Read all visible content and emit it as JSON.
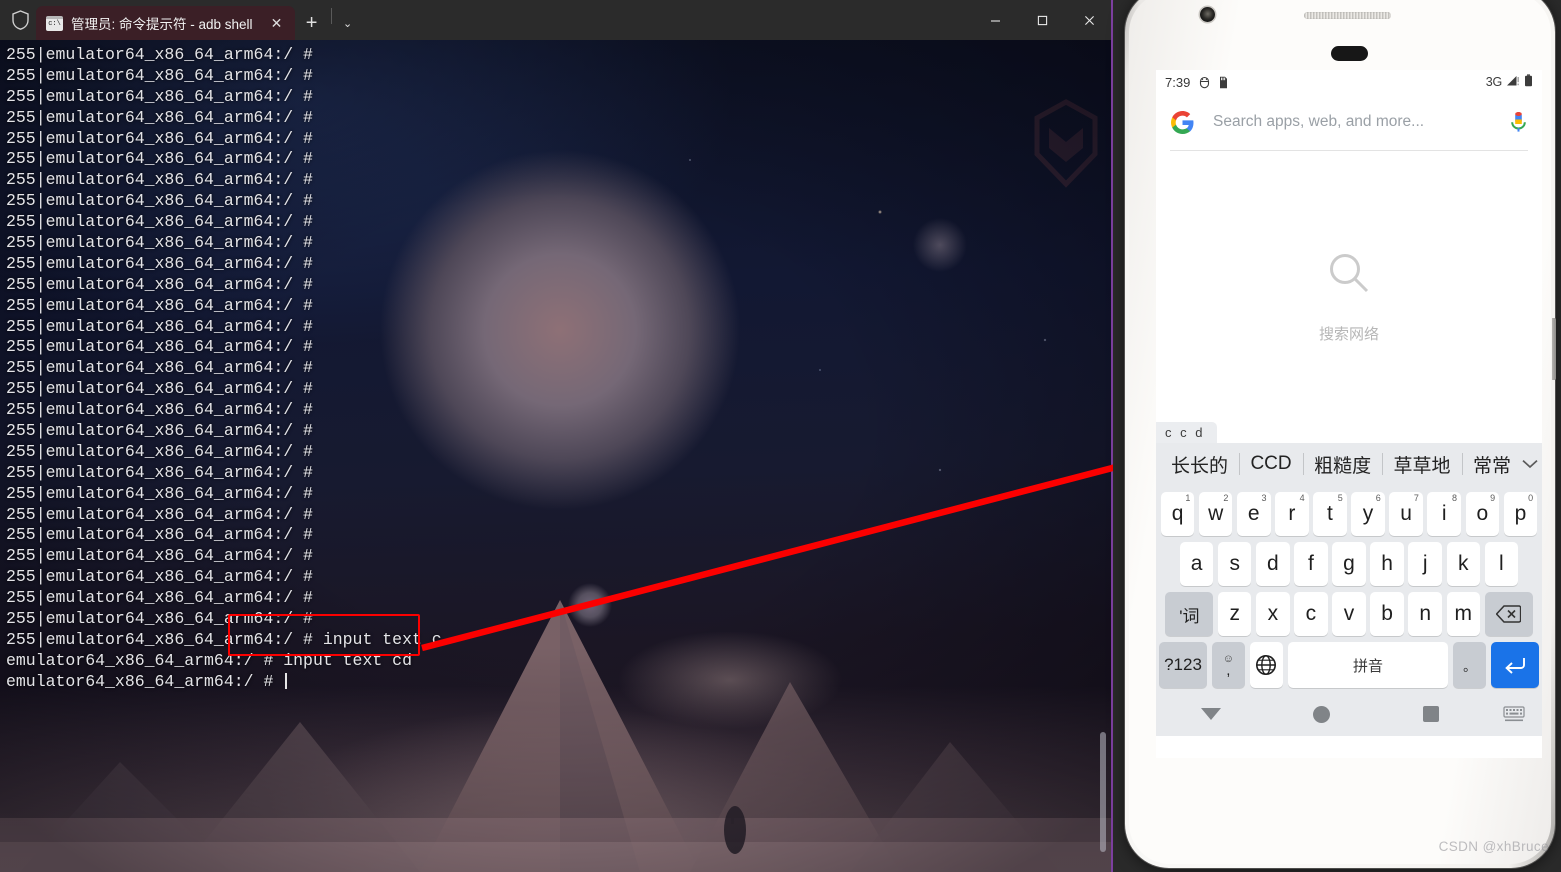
{
  "window": {
    "shield_icon": "shield-icon",
    "tab_icon": "console-icon",
    "tab_title": "管理员: 命令提示符 - adb  shell",
    "tab_close_label": "✕",
    "new_tab_label": "+",
    "tab_dropdown_label": "⌄",
    "minimize_label": "minimize-icon",
    "maximize_label": "maximize-icon",
    "close_label": "close-icon"
  },
  "terminal": {
    "prompt_repeat": "255|emulator64_x86_64_arm64:/ #",
    "repeat_count": 28,
    "lines": [
      "255|emulator64_x86_64_arm64:/ # input text c",
      "emulator64_x86_64_arm64:/ # input text cd",
      "emulator64_x86_64_arm64:/ # "
    ],
    "commands": [
      "input text c",
      "input text cd"
    ],
    "annotation_color": "#fb0000"
  },
  "phone": {
    "status": {
      "time": "7:39",
      "icons": [
        "usb-debug-icon",
        "sdcard-icon"
      ],
      "network": "3G",
      "signal_icon": "signal-bars-icon",
      "battery_icon": "battery-icon"
    },
    "search": {
      "logo": "google-g-icon",
      "placeholder": "Search apps, web, and more...",
      "mic_icon": "microphone-icon"
    },
    "empty_state": {
      "icon": "magnifier-icon",
      "label": "搜索网络"
    },
    "compose": {
      "text": "c c d"
    },
    "candidates": {
      "items": [
        "长长的",
        "CCD",
        "粗糙度",
        "草草地",
        "常常"
      ],
      "expand_icon": "chevron-down-icon"
    },
    "keyboard": {
      "row1": [
        {
          "key": "q",
          "num": "1"
        },
        {
          "key": "w",
          "num": "2"
        },
        {
          "key": "e",
          "num": "3"
        },
        {
          "key": "r",
          "num": "4"
        },
        {
          "key": "t",
          "num": "5"
        },
        {
          "key": "y",
          "num": "6"
        },
        {
          "key": "u",
          "num": "7"
        },
        {
          "key": "i",
          "num": "8"
        },
        {
          "key": "o",
          "num": "9"
        },
        {
          "key": "p",
          "num": "0"
        }
      ],
      "row2": [
        "a",
        "s",
        "d",
        "f",
        "g",
        "h",
        "j",
        "k",
        "l"
      ],
      "row3_shift": "'词",
      "row3": [
        "z",
        "x",
        "c",
        "v",
        "b",
        "n",
        "m"
      ],
      "row3_backspace": "backspace-icon",
      "row4": {
        "symbols": "?123",
        "emoji_top": "☺",
        "emoji_bottom": ",",
        "globe": "globe-icon",
        "space": "拼音",
        "period": "。",
        "enter": "enter-icon"
      },
      "accent_color": "#1a73e8"
    },
    "nav": {
      "back": "back-triangle-icon",
      "home": "home-circle-icon",
      "recents": "recents-square-icon",
      "keyboard_switch": "keyboard-switch-icon"
    }
  },
  "watermark": "CSDN @xhBruce"
}
